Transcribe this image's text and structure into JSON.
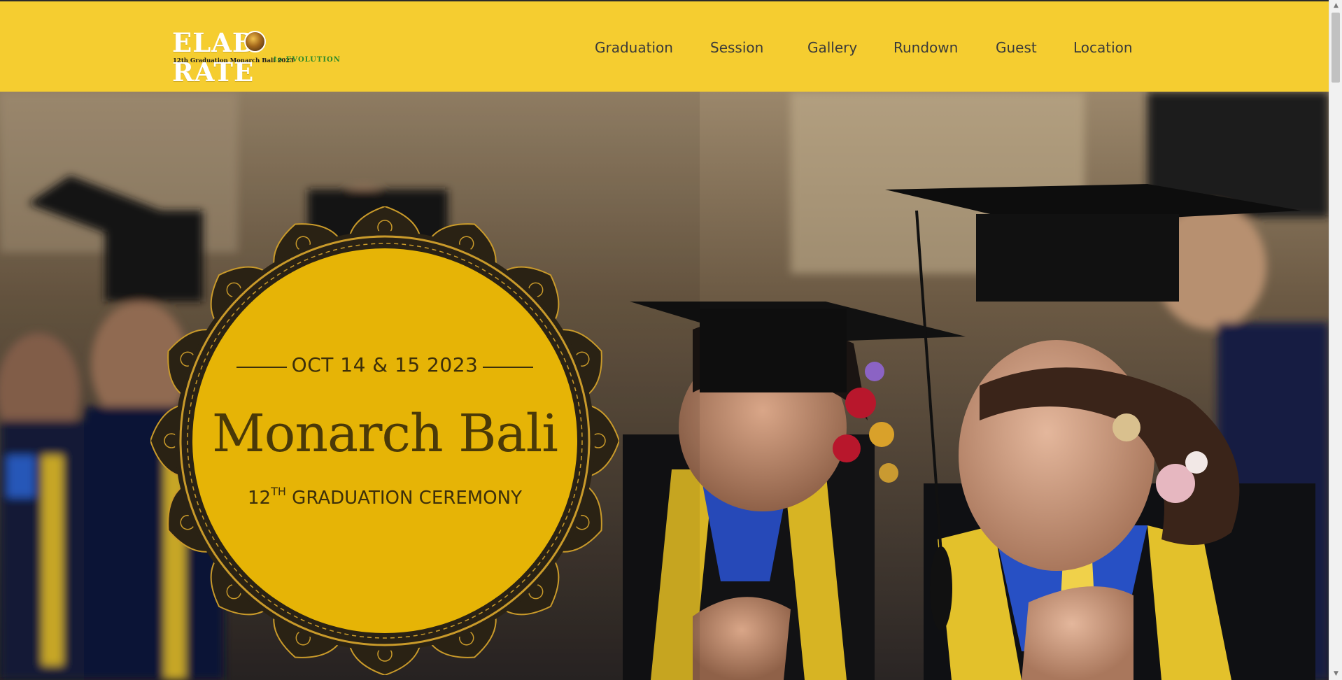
{
  "header": {
    "logo": {
      "word": "ELAB RATE",
      "subtitle": "12th Graduation Monarch Bali 2023",
      "tagline": "to EVOLUTION"
    },
    "nav": [
      {
        "label": "Graduation"
      },
      {
        "label": "Session"
      },
      {
        "label": "Gallery"
      },
      {
        "label": "Rundown"
      },
      {
        "label": "Guest"
      },
      {
        "label": "Location"
      }
    ]
  },
  "hero": {
    "date": "OCT 14 & 15 2023",
    "title": "Monarch Bali",
    "subtitle_number": "12",
    "subtitle_sup": "TH",
    "subtitle_rest": " GRADUATION CEREMONY"
  },
  "colors": {
    "header_bg": "#f5cd30",
    "badge_fill": "#e6b406",
    "badge_text": "#4a3908",
    "nav_text": "#3a3a3a"
  }
}
